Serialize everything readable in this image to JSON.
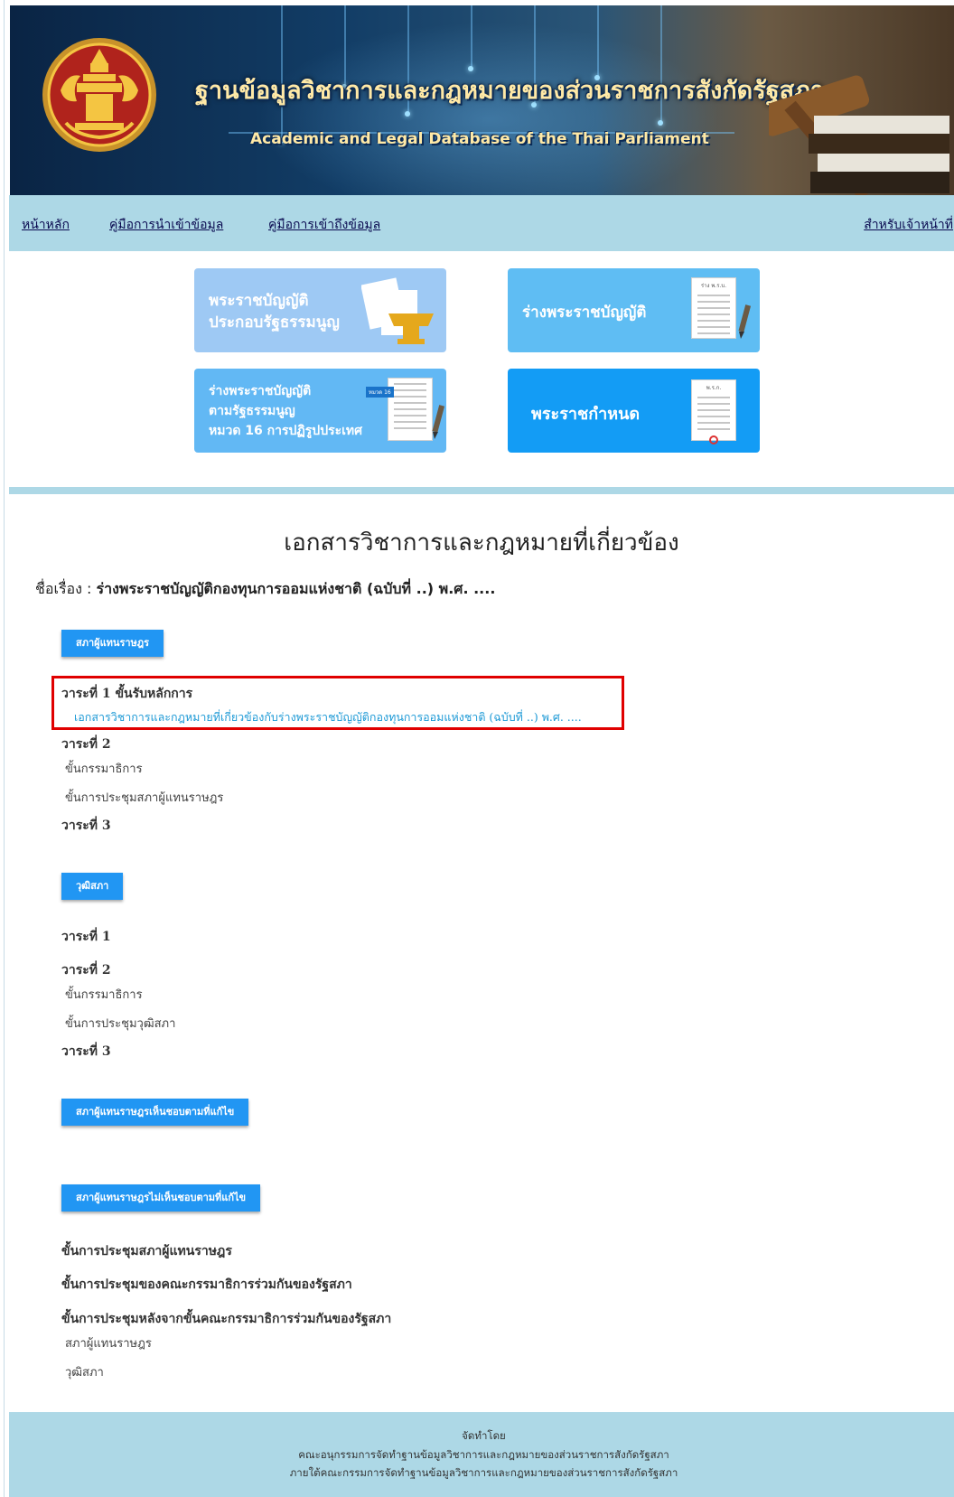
{
  "banner": {
    "title_th": "ฐานข้อมูลวิชาการและกฎหมายของส่วนราชการสังกัดรัฐสภา",
    "title_en": "Academic and Legal Database of the Thai Parliament",
    "emblem": "thai-parliament-emblem-icon"
  },
  "nav": {
    "home": "หน้าหลัก",
    "import_guide": "คู่มือการนำเข้าข้อมูล",
    "access_guide": "คู่มือการเข้าถึงข้อมูล",
    "staff": "สำหรับเจ้าหน้าที่"
  },
  "tiles": {
    "organic_act": {
      "line1": "พระราชบัญญัติ",
      "line2": "ประกอบรัฐธรรมนูญ",
      "color": "#9ec9f4"
    },
    "draft_act": {
      "label": "ร่างพระราชบัญญัติ",
      "doc_label": "ร่าง พ.ร.บ.",
      "color": "#5fbdf3"
    },
    "draft_act_ch16": {
      "line1": "ร่างพระราชบัญญัติ",
      "line2": "ตามรัฐธรรมนูญ",
      "line3": "หมวด 16 การปฏิรูปประเทศ",
      "badge": "หมวด 16",
      "color": "#62b8f4"
    },
    "royal_decree": {
      "label": "พระราชกำหนด",
      "doc_label": "พ.ร.ก.",
      "color": "#139cf5"
    }
  },
  "main": {
    "section_title": "เอกสารวิชาการและกฎหมายที่เกี่ยวข้อง",
    "subject_label": "ชื่อเรื่อง : ",
    "subject_value": "ร่างพระราชบัญญัติกองทุนการออมแห่งชาติ (ฉบับที่ ..) พ.ศ. ...."
  },
  "house": {
    "button": "สภาผู้แทนราษฎร",
    "r1": "วาระที่ 1 ขั้นรับหลักการ",
    "r1_doc": "เอกสารวิชาการและกฎหมายที่เกี่ยวข้องกับร่างพระราชบัญญัติกองทุนการออมแห่งชาติ (ฉบับที่ ..) พ.ศ. ....",
    "r2": "วาระที่ 2",
    "r2_committee": "ขั้นกรรมาธิการ",
    "r2_meeting": "ขั้นการประชุมสภาผู้แทนราษฎร",
    "r3": "วาระที่ 3"
  },
  "senate": {
    "button": "วุฒิสภา",
    "r1": "วาระที่ 1",
    "r2": "วาระที่ 2",
    "r2_committee": "ขั้นกรรมาธิการ",
    "r2_meeting": "ขั้นการประชุมวุฒิสภา",
    "r3": "วาระที่ 3"
  },
  "agree": {
    "button": "สภาผู้แทนราษฎรเห็นชอบตามที่แก้ไข"
  },
  "disagree": {
    "button": "สภาผู้แทนราษฎรไม่เห็นชอบตามที่แก้ไข",
    "s1": "ขั้นการประชุมสภาผู้แทนราษฎร",
    "s2": "ขั้นการประชุมของคณะกรรมาธิการร่วมกันของรัฐสภา",
    "s3": "ขั้นการประชุมหลังจากขั้นคณะกรรมาธิการร่วมกันของรัฐสภา",
    "s3_house": "สภาผู้แทนราษฎร",
    "s3_senate": "วุฒิสภา"
  },
  "footer": {
    "line1": "จัดทำโดย",
    "line2": "คณะอนุกรรมการจัดทำฐานข้อมูลวิชาการและกฎหมายของส่วนราชการสังกัดรัฐสภา",
    "line3": "ภายใต้คณะกรรมการจัดทำฐานข้อมูลวิชาการและกฎหมายของส่วนราชการสังกัดรัฐสภา"
  }
}
